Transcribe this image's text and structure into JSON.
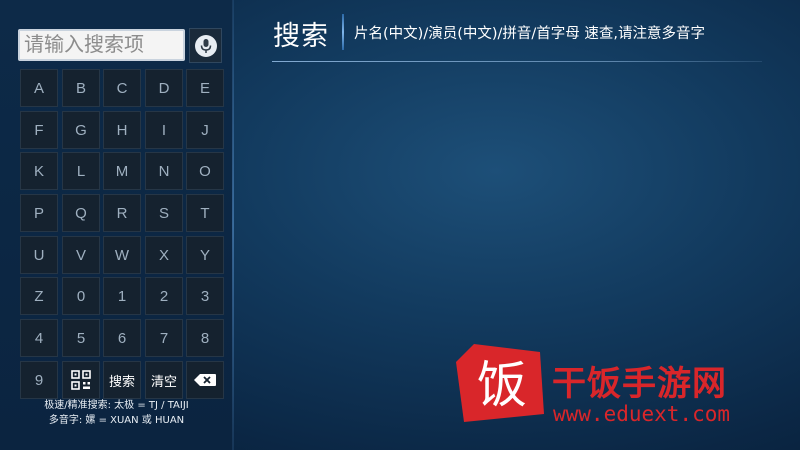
{
  "search": {
    "placeholder": "请输入搜索项",
    "mic_icon": "microphone-icon"
  },
  "keyboard": {
    "rows": [
      [
        "A",
        "B",
        "C",
        "D",
        "E"
      ],
      [
        "F",
        "G",
        "H",
        "I",
        "J"
      ],
      [
        "K",
        "L",
        "M",
        "N",
        "O"
      ],
      [
        "P",
        "Q",
        "R",
        "S",
        "T"
      ],
      [
        "U",
        "V",
        "W",
        "X",
        "Y"
      ],
      [
        "Z",
        "0",
        "1",
        "2",
        "3"
      ],
      [
        "4",
        "5",
        "6",
        "7",
        "8"
      ]
    ],
    "bottom_row": {
      "nine": "9",
      "qr_icon": "qr-code-icon",
      "search_label": "搜索",
      "clear_label": "清空",
      "backspace_icon": "backspace-icon"
    }
  },
  "hints": {
    "line1": "极速/精准搜索: 太极 = TJ / TAIJI",
    "line2": "多音字: 嫘 = XUAN 或 HUAN"
  },
  "header": {
    "title": "搜索",
    "subtitle": "片名(中文)/演员(中文)/拼音/首字母 速查,请注意多音字"
  },
  "watermark": {
    "logo_char": "饭",
    "name": "干饭手游网",
    "url": "www.eduext.com"
  },
  "colors": {
    "background": "#123a5e",
    "key_background": "#15222f",
    "watermark": "#d9262a"
  }
}
